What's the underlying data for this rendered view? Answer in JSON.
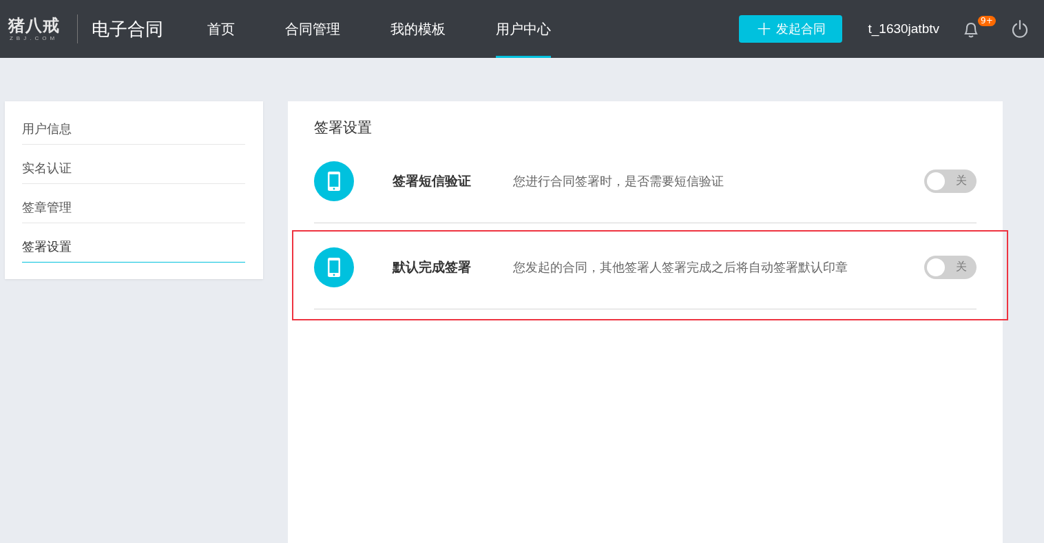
{
  "logo": {
    "mark": "猪八戒",
    "domain": "ZBJ.COM"
  },
  "app_title": "电子合同",
  "nav": [
    {
      "label": "首页",
      "selected": false
    },
    {
      "label": "合同管理",
      "selected": false
    },
    {
      "label": "我的模板",
      "selected": false
    },
    {
      "label": "用户中心",
      "selected": true
    }
  ],
  "new_contract_button": {
    "icon": "+",
    "label": "发起合同"
  },
  "username": "t_1630jatbtv",
  "notifications": {
    "badge": "9+"
  },
  "sidebar": {
    "items": [
      {
        "label": "用户信息",
        "selected": false
      },
      {
        "label": "实名认证",
        "selected": false
      },
      {
        "label": "签章管理",
        "selected": false
      },
      {
        "label": "签署设置",
        "selected": true
      }
    ]
  },
  "panel": {
    "title": "签署设置",
    "settings": [
      {
        "name": "签署短信验证",
        "description": "您进行合同签署时，是否需要短信验证",
        "on": false,
        "toggle_label": "关",
        "highlighted": false
      },
      {
        "name": "默认完成签署",
        "description": "您发起的合同，其他签署人签署完成之后将自动签署默认印章",
        "on": false,
        "toggle_label": "关",
        "highlighted": true
      }
    ]
  }
}
